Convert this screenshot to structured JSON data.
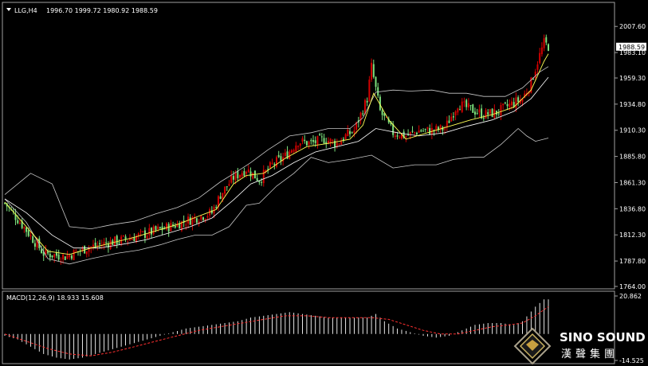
{
  "header": {
    "symbol": "LLG,H4",
    "ohlc": "1996.70 1999.72 1980.92 1988.59"
  },
  "current_price": "1988.59",
  "macd_header": "MACD(12,26,9) 18.933 15.608",
  "logo": {
    "english": "SINO SOUND",
    "chinese": "漢聲集團"
  },
  "colors": {
    "background": "#000000",
    "bull": "#d40000",
    "bear": "#7ce07c",
    "bollinger": "#c8c8c8",
    "ma_fast": "#ffff55",
    "ma_slow": "#ffffff",
    "macd_hist": "#ffffff",
    "macd_signal": "#ff3030"
  },
  "chart_data": [
    {
      "type": "candlestick",
      "title": "LLG,H4",
      "y_ticks": [
        "2007.60",
        "1983.10",
        "1959.30",
        "1934.80",
        "1910.30",
        "1885.80",
        "1861.30",
        "1836.80",
        "1812.30",
        "1787.80",
        "1764.00"
      ],
      "ylim": [
        1764.0,
        2010.0
      ],
      "n_bars": 130,
      "close_path": [
        [
          0,
          1842
        ],
        [
          8,
          1822
        ],
        [
          18,
          1795
        ],
        [
          28,
          1792
        ],
        [
          38,
          1800
        ],
        [
          48,
          1805
        ],
        [
          58,
          1809
        ],
        [
          68,
          1815
        ],
        [
          78,
          1821
        ],
        [
          88,
          1828
        ],
        [
          96,
          1833
        ],
        [
          100,
          1850
        ],
        [
          106,
          1866
        ],
        [
          112,
          1874
        ],
        [
          118,
          1864
        ],
        [
          124,
          1878
        ],
        [
          130,
          1886
        ],
        [
          136,
          1900
        ],
        [
          142,
          1898
        ],
        [
          148,
          1902
        ],
        [
          154,
          1898
        ],
        [
          158,
          1905
        ],
        [
          162,
          1910
        ],
        [
          165,
          1925
        ],
        [
          168,
          1940
        ],
        [
          170,
          1970
        ],
        [
          174,
          1928
        ],
        [
          180,
          1908
        ],
        [
          186,
          1905
        ],
        [
          192,
          1910
        ],
        [
          198,
          1910
        ],
        [
          204,
          1912
        ],
        [
          210,
          1935
        ],
        [
          216,
          1930
        ],
        [
          222,
          1925
        ],
        [
          228,
          1927
        ],
        [
          234,
          1934
        ],
        [
          240,
          1940
        ],
        [
          244,
          1955
        ],
        [
          247,
          1975
        ],
        [
          250,
          1992
        ],
        [
          252,
          1989
        ]
      ],
      "bollinger_upper": [
        [
          0,
          1850
        ],
        [
          12,
          1870
        ],
        [
          22,
          1860
        ],
        [
          30,
          1820
        ],
        [
          40,
          1818
        ],
        [
          50,
          1822
        ],
        [
          60,
          1825
        ],
        [
          70,
          1832
        ],
        [
          80,
          1838
        ],
        [
          90,
          1847
        ],
        [
          100,
          1862
        ],
        [
          108,
          1872
        ],
        [
          114,
          1880
        ],
        [
          122,
          1892
        ],
        [
          132,
          1905
        ],
        [
          142,
          1908
        ],
        [
          150,
          1912
        ],
        [
          160,
          1912
        ],
        [
          166,
          1922
        ],
        [
          172,
          1946
        ],
        [
          180,
          1948
        ],
        [
          188,
          1947
        ],
        [
          198,
          1948
        ],
        [
          206,
          1945
        ],
        [
          214,
          1945
        ],
        [
          222,
          1942
        ],
        [
          232,
          1942
        ],
        [
          240,
          1950
        ],
        [
          248,
          1965
        ],
        [
          252,
          1970
        ]
      ],
      "bollinger_lower": [
        [
          0,
          1846
        ],
        [
          10,
          1824
        ],
        [
          20,
          1790
        ],
        [
          30,
          1785
        ],
        [
          40,
          1790
        ],
        [
          52,
          1795
        ],
        [
          62,
          1798
        ],
        [
          72,
          1803
        ],
        [
          80,
          1808
        ],
        [
          88,
          1812
        ],
        [
          96,
          1812
        ],
        [
          104,
          1820
        ],
        [
          112,
          1840
        ],
        [
          118,
          1842
        ],
        [
          126,
          1858
        ],
        [
          134,
          1870
        ],
        [
          142,
          1885
        ],
        [
          150,
          1880
        ],
        [
          160,
          1883
        ],
        [
          170,
          1887
        ],
        [
          180,
          1875
        ],
        [
          190,
          1878
        ],
        [
          200,
          1878
        ],
        [
          208,
          1883
        ],
        [
          216,
          1885
        ],
        [
          222,
          1885
        ],
        [
          230,
          1897
        ],
        [
          238,
          1912
        ],
        [
          242,
          1905
        ],
        [
          246,
          1900
        ],
        [
          252,
          1903
        ]
      ],
      "ma_fast": [
        [
          0,
          1843
        ],
        [
          10,
          1820
        ],
        [
          20,
          1797
        ],
        [
          30,
          1794
        ],
        [
          40,
          1800
        ],
        [
          50,
          1805
        ],
        [
          60,
          1810
        ],
        [
          70,
          1816
        ],
        [
          80,
          1822
        ],
        [
          90,
          1830
        ],
        [
          98,
          1836
        ],
        [
          106,
          1860
        ],
        [
          112,
          1868
        ],
        [
          120,
          1870
        ],
        [
          130,
          1884
        ],
        [
          140,
          1895
        ],
        [
          150,
          1898
        ],
        [
          160,
          1902
        ],
        [
          166,
          1915
        ],
        [
          171,
          1945
        ],
        [
          178,
          1920
        ],
        [
          186,
          1902
        ],
        [
          196,
          1908
        ],
        [
          206,
          1914
        ],
        [
          216,
          1920
        ],
        [
          226,
          1925
        ],
        [
          236,
          1932
        ],
        [
          244,
          1948
        ],
        [
          250,
          1975
        ],
        [
          252,
          1982
        ]
      ],
      "ma_slow": [
        [
          0,
          1846
        ],
        [
          10,
          1833
        ],
        [
          22,
          1812
        ],
        [
          32,
          1800
        ],
        [
          44,
          1800
        ],
        [
          56,
          1804
        ],
        [
          66,
          1808
        ],
        [
          76,
          1814
        ],
        [
          86,
          1820
        ],
        [
          96,
          1828
        ],
        [
          106,
          1845
        ],
        [
          114,
          1860
        ],
        [
          124,
          1868
        ],
        [
          134,
          1880
        ],
        [
          144,
          1890
        ],
        [
          154,
          1895
        ],
        [
          164,
          1900
        ],
        [
          172,
          1912
        ],
        [
          182,
          1908
        ],
        [
          192,
          1905
        ],
        [
          204,
          1908
        ],
        [
          214,
          1914
        ],
        [
          226,
          1920
        ],
        [
          236,
          1928
        ],
        [
          244,
          1940
        ],
        [
          250,
          1955
        ],
        [
          252,
          1960
        ]
      ]
    },
    {
      "type": "bar",
      "title": "MACD(12,26,9) 18.933 15.608",
      "y_ticks": [
        "20.862",
        "-14.525"
      ],
      "ylim": [
        -14.525,
        20.862
      ],
      "histogram": [
        [
          0,
          -1
        ],
        [
          6,
          -3
        ],
        [
          12,
          -7
        ],
        [
          18,
          -11
        ],
        [
          24,
          -13
        ],
        [
          30,
          -14
        ],
        [
          36,
          -13
        ],
        [
          42,
          -11
        ],
        [
          48,
          -9
        ],
        [
          54,
          -7
        ],
        [
          60,
          -5
        ],
        [
          66,
          -3
        ],
        [
          72,
          -1
        ],
        [
          78,
          1
        ],
        [
          84,
          3
        ],
        [
          90,
          4
        ],
        [
          96,
          5
        ],
        [
          102,
          6
        ],
        [
          108,
          7
        ],
        [
          114,
          9
        ],
        [
          120,
          10
        ],
        [
          126,
          11
        ],
        [
          132,
          12
        ],
        [
          138,
          11
        ],
        [
          144,
          10
        ],
        [
          150,
          9
        ],
        [
          156,
          9
        ],
        [
          162,
          9
        ],
        [
          168,
          9
        ],
        [
          172,
          11
        ],
        [
          176,
          7
        ],
        [
          182,
          3
        ],
        [
          188,
          1
        ],
        [
          194,
          -1
        ],
        [
          200,
          -2
        ],
        [
          206,
          -1
        ],
        [
          212,
          2
        ],
        [
          218,
          5
        ],
        [
          224,
          6
        ],
        [
          230,
          6
        ],
        [
          236,
          5
        ],
        [
          240,
          7
        ],
        [
          246,
          15
        ],
        [
          250,
          19
        ],
        [
          252,
          19
        ]
      ],
      "signal": [
        [
          0,
          0
        ],
        [
          10,
          -4
        ],
        [
          20,
          -8
        ],
        [
          30,
          -11
        ],
        [
          40,
          -12
        ],
        [
          50,
          -10
        ],
        [
          60,
          -7
        ],
        [
          70,
          -4
        ],
        [
          80,
          -1
        ],
        [
          90,
          2
        ],
        [
          100,
          4
        ],
        [
          110,
          6
        ],
        [
          120,
          8
        ],
        [
          130,
          10
        ],
        [
          140,
          10
        ],
        [
          150,
          9
        ],
        [
          160,
          9
        ],
        [
          170,
          9
        ],
        [
          178,
          8
        ],
        [
          186,
          5
        ],
        [
          194,
          2
        ],
        [
          202,
          0
        ],
        [
          210,
          0
        ],
        [
          218,
          2
        ],
        [
          226,
          4
        ],
        [
          234,
          5
        ],
        [
          240,
          6
        ],
        [
          246,
          10
        ],
        [
          252,
          15
        ]
      ]
    }
  ]
}
